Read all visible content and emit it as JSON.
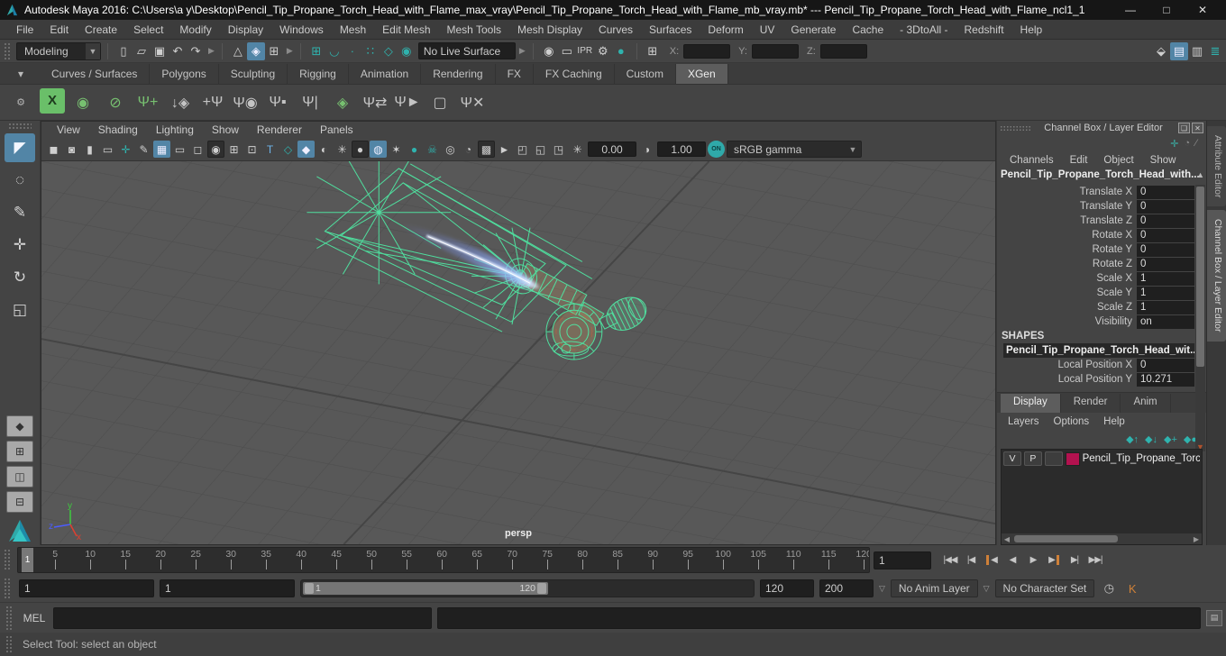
{
  "titlebar": {
    "title": "Autodesk Maya 2016: C:\\Users\\a y\\Desktop\\Pencil_Tip_Propane_Torch_Head_with_Flame_max_vray\\Pencil_Tip_Propane_Torch_Head_with_Flame_mb_vray.mb*  ---  Pencil_Tip_Propane_Torch_Head_with_Flame_ncl1_1",
    "minimize": "—",
    "maximize": "□",
    "close": "✕"
  },
  "menubar": {
    "items": [
      "File",
      "Edit",
      "Create",
      "Select",
      "Modify",
      "Display",
      "Windows",
      "Mesh",
      "Edit Mesh",
      "Mesh Tools",
      "Mesh Display",
      "Curves",
      "Surfaces",
      "Deform",
      "UV",
      "Generate",
      "Cache",
      "- 3DtoAll -",
      "Redshift",
      "Help"
    ]
  },
  "toolbar": {
    "mode_selector": "Modeling",
    "file_icons": [
      {
        "name": "new-scene-icon",
        "glyph": "▯"
      },
      {
        "name": "open-scene-icon",
        "glyph": "▱"
      },
      {
        "name": "save-scene-icon",
        "glyph": "▣"
      },
      {
        "name": "undo-icon",
        "glyph": "↶"
      },
      {
        "name": "redo-icon",
        "glyph": "↷"
      }
    ],
    "selection_icons": [
      {
        "name": "select-hierarchy-icon",
        "glyph": "△"
      },
      {
        "name": "select-object-icon",
        "glyph": "◈",
        "state": "active"
      },
      {
        "name": "select-component-icon",
        "glyph": "⊞"
      }
    ],
    "snap_icons": [
      {
        "name": "snap-grid-icon",
        "glyph": "⊞",
        "state": "teal"
      },
      {
        "name": "snap-curve-icon",
        "glyph": "◡",
        "state": "teal"
      },
      {
        "name": "snap-point-icon",
        "glyph": "∙",
        "state": "teal"
      },
      {
        "name": "snap-projected-center-icon",
        "glyph": "∷",
        "state": "teal"
      },
      {
        "name": "snap-view-plane-icon",
        "glyph": "◇",
        "state": "teal"
      },
      {
        "name": "make-live-icon",
        "glyph": "◉",
        "state": "teal"
      }
    ],
    "live_surface_value": "No Live Surface",
    "render_icons": [
      {
        "name": "render-view-icon",
        "glyph": "◉"
      },
      {
        "name": "render-current-frame-icon",
        "glyph": "▭"
      },
      {
        "name": "ipr-render-icon",
        "glyph": "IPR",
        "state": "small-t"
      },
      {
        "name": "render-settings-icon",
        "glyph": "⚙"
      },
      {
        "name": "current-renderer-icon",
        "glyph": "●",
        "state": "teal"
      }
    ],
    "symmetry_icon": {
      "name": "symmetry-icon",
      "glyph": "⊞"
    },
    "x_label": "X:",
    "y_label": "Y:",
    "z_label": "Z:",
    "sidebar_icons": [
      {
        "name": "modeling-toolkit-icon",
        "glyph": "⬙"
      },
      {
        "name": "channel-box-icon",
        "glyph": "▤",
        "state": "active"
      },
      {
        "name": "attribute-editor-icon",
        "glyph": "▥"
      },
      {
        "name": "tool-settings-icon",
        "glyph": "≣",
        "state": "teal"
      }
    ]
  },
  "shelf": {
    "tabs": [
      {
        "label": "Curves / Surfaces"
      },
      {
        "label": "Polygons"
      },
      {
        "label": "Sculpting"
      },
      {
        "label": "Rigging"
      },
      {
        "label": "Animation"
      },
      {
        "label": "Rendering"
      },
      {
        "label": "FX"
      },
      {
        "label": "FX Caching"
      },
      {
        "label": "Custom"
      },
      {
        "label": "XGen",
        "state": "active"
      }
    ],
    "menu_icon": "▾",
    "gear_icon": "⚙",
    "icons": [
      {
        "name": "xgen-editor-icon",
        "glyph": "X",
        "state": "box"
      },
      {
        "name": "xgen-update-preview-icon",
        "glyph": "◉",
        "state": "green"
      },
      {
        "name": "xgen-hide-preview-icon",
        "glyph": "⊘",
        "state": "green"
      },
      {
        "name": "xgen-create-description-icon",
        "glyph": "Ψ+",
        "state": "green"
      },
      {
        "name": "xgen-import-description-icon",
        "glyph": "↓◈"
      },
      {
        "name": "xgen-add-guide-icon",
        "glyph": "+Ψ"
      },
      {
        "name": "xgen-preview-description-icon",
        "glyph": "Ψ◉"
      },
      {
        "name": "xgen-lock-guides-icon",
        "glyph": "Ψ▪"
      },
      {
        "name": "xgen-mirror-guides-icon",
        "glyph": "Ψ|"
      },
      {
        "name": "xgen-layers-icon",
        "glyph": "◈",
        "state": "green"
      },
      {
        "name": "xgen-swap-guides-icon",
        "glyph": "Ψ⇄"
      },
      {
        "name": "xgen-select-guides-icon",
        "glyph": "Ψ►"
      },
      {
        "name": "xgen-region-map-icon",
        "glyph": "▢"
      },
      {
        "name": "xgen-delete-guides-icon",
        "glyph": "Ψ✕"
      }
    ]
  },
  "toolbox": {
    "tools": [
      {
        "name": "select-tool-button",
        "glyph": "◤",
        "state": "active"
      },
      {
        "name": "lasso-tool-button",
        "glyph": "◌"
      },
      {
        "name": "paint-select-tool-button",
        "glyph": "✎"
      },
      {
        "name": "move-tool-button",
        "glyph": "✛"
      },
      {
        "name": "rotate-tool-button",
        "glyph": "↻"
      },
      {
        "name": "scale-tool-button",
        "glyph": "◱"
      }
    ],
    "layouts": [
      {
        "name": "single-pane-layout-button",
        "glyph": "◆"
      },
      {
        "name": "four-pane-layout-button",
        "glyph": "⊞"
      },
      {
        "name": "persp-outliner-layout-button",
        "glyph": "◫"
      },
      {
        "name": "persp-graph-layout-button",
        "glyph": "⊟"
      }
    ]
  },
  "viewport": {
    "menus": [
      "View",
      "Shading",
      "Lighting",
      "Show",
      "Renderer",
      "Panels"
    ],
    "toolbar_icons": [
      {
        "name": "select-camera-icon",
        "glyph": "◼"
      },
      {
        "name": "camera-attributes-icon",
        "glyph": "◙"
      },
      {
        "name": "bookmark-icon",
        "glyph": "▮"
      },
      {
        "name": "image-plane-icon",
        "glyph": "▭"
      },
      {
        "name": "pan-zoom-icon",
        "glyph": "✛",
        "state": "teal"
      },
      {
        "name": "grease-pencil-icon",
        "glyph": "✎"
      },
      {
        "name": "grid-icon",
        "glyph": "▦",
        "state": "active"
      },
      {
        "name": "film-gate-icon",
        "glyph": "▭"
      },
      {
        "name": "resolution-gate-icon",
        "glyph": "◻"
      },
      {
        "name": "gate-mask-icon",
        "glyph": "◉",
        "state": "pressed"
      },
      {
        "name": "field-chart-icon",
        "glyph": "⊞"
      },
      {
        "name": "safe-action-icon",
        "glyph": "⊡"
      },
      {
        "name": "safe-title-icon",
        "glyph": "T",
        "state": "blue-text"
      },
      {
        "name": "wireframe-icon",
        "glyph": "◇",
        "state": "teal"
      },
      {
        "name": "shaded-icon",
        "glyph": "◆",
        "state": "active"
      },
      {
        "name": "textured-icon",
        "glyph": "◐"
      },
      {
        "name": "use-all-lights-icon",
        "glyph": "✳"
      },
      {
        "name": "shadows-icon",
        "glyph": "●",
        "state": "pressed"
      },
      {
        "name": "ambient-occlusion-icon",
        "glyph": "◍",
        "state": "active"
      },
      {
        "name": "motion-blur-icon",
        "glyph": "✶"
      },
      {
        "name": "default-material-icon",
        "glyph": "●",
        "state": "teal"
      },
      {
        "name": "xray-icon",
        "glyph": "☠",
        "state": "teal"
      },
      {
        "name": "xray-joints-icon",
        "glyph": "◎"
      },
      {
        "name": "backface-culling-icon",
        "glyph": "◔"
      },
      {
        "name": "transparency-sort-icon",
        "glyph": "▩",
        "state": "pressed"
      },
      {
        "name": "selection-preview-icon",
        "glyph": "►"
      },
      {
        "name": "isolate-select-icon",
        "glyph": "◰"
      },
      {
        "name": "isolate-add-icon",
        "glyph": "◱"
      },
      {
        "name": "isolate-view-icon",
        "glyph": "◳"
      }
    ],
    "exposure_icon": "✳",
    "exposure_value": "0.00",
    "contrast_icon": "◑",
    "contrast_value": "1.00",
    "on_label": "ON",
    "colorspace": "sRGB gamma",
    "colorspace_arrow": "▼",
    "camera_label": "persp",
    "axis_x": "x",
    "axis_y": "y",
    "axis_z": "z"
  },
  "channel_box": {
    "title": "Channel Box / Layer Editor",
    "float_icon": "❏",
    "close_icon": "✕",
    "manip_icons": [
      {
        "name": "channel-manipulator-icon",
        "glyph": "✛",
        "color": "#3bb0a5"
      },
      {
        "name": "channel-speed-icon",
        "glyph": "◔",
        "color": "#8a8a8a"
      },
      {
        "name": "channel-hyperbolic-icon",
        "glyph": "⁄",
        "color": "#8a8a8a"
      }
    ],
    "menus": [
      "Channels",
      "Edit",
      "Object",
      "Show"
    ],
    "node_name": "Pencil_Tip_Propane_Torch_Head_with...",
    "scroll_up_icon": "▲",
    "scroll_down_icon": "▼",
    "channels": [
      {
        "label": "Translate X",
        "value": "0"
      },
      {
        "label": "Translate Y",
        "value": "0"
      },
      {
        "label": "Translate Z",
        "value": "0"
      },
      {
        "label": "Rotate X",
        "value": "0"
      },
      {
        "label": "Rotate Y",
        "value": "0"
      },
      {
        "label": "Rotate Z",
        "value": "0"
      },
      {
        "label": "Scale X",
        "value": "1"
      },
      {
        "label": "Scale Y",
        "value": "1"
      },
      {
        "label": "Scale Z",
        "value": "1"
      },
      {
        "label": "Visibility",
        "value": "on"
      }
    ],
    "shapes_header": "SHAPES",
    "shape_node": "Pencil_Tip_Propane_Torch_Head_wit...",
    "shape_channels": [
      {
        "label": "Local Position X",
        "value": "0"
      },
      {
        "label": "Local Position Y",
        "value": "10.271"
      }
    ]
  },
  "layer_editor": {
    "tabs": [
      {
        "label": "Display",
        "state": "active"
      },
      {
        "label": "Render"
      },
      {
        "label": "Anim"
      }
    ],
    "menus": [
      "Layers",
      "Options",
      "Help"
    ],
    "icons": [
      {
        "name": "move-layer-up-icon",
        "glyph": "◆↑"
      },
      {
        "name": "move-layer-down-icon",
        "glyph": "◆↓"
      },
      {
        "name": "create-empty-layer-icon",
        "glyph": "◆+"
      },
      {
        "name": "create-layer-from-selected-icon",
        "glyph": "◆●"
      }
    ],
    "layer": {
      "visible": "V",
      "playback": "P",
      "name": "Pencil_Tip_Propane_Torc",
      "color": "#b3124f"
    },
    "hscroll_left": "◀",
    "hscroll_right": "▶"
  },
  "side_tabs": [
    {
      "label": "Attribute Editor"
    },
    {
      "label": "Channel Box / Layer Editor",
      "state": "active"
    }
  ],
  "timeline": {
    "tick_labels": [
      "5",
      "10",
      "15",
      "20",
      "25",
      "30",
      "35",
      "40",
      "45",
      "50",
      "55",
      "60",
      "65",
      "70",
      "75",
      "80",
      "85",
      "90",
      "95",
      "100",
      "105",
      "110",
      "115",
      "120"
    ],
    "current_marker": "1",
    "current_frame": "1",
    "playback_buttons": [
      {
        "name": "go-to-start-button",
        "glyph": "|◀◀"
      },
      {
        "name": "step-back-frame-button",
        "glyph": "|◀"
      },
      {
        "name": "step-back-key-button",
        "glyph": "◀",
        "bar": "bar-left"
      },
      {
        "name": "play-backwards-button",
        "glyph": "◀"
      },
      {
        "name": "play-forwards-button",
        "glyph": "▶"
      },
      {
        "name": "step-forward-key-button",
        "glyph": "▶",
        "bar": "bar-right"
      },
      {
        "name": "step-forward-frame-button",
        "glyph": "▶|"
      },
      {
        "name": "go-to-end-button",
        "glyph": "▶▶|"
      }
    ]
  },
  "range_slider": {
    "anim_start": "1",
    "playback_start": "1",
    "bar_start_label": "1",
    "bar_end_label": "120",
    "playback_end": "120",
    "anim_end": "200",
    "dropdown_arrow": "▽",
    "anim_layer": "No Anim Layer",
    "character_set": "No Character Set",
    "prefs_icon": "◷",
    "auto_key_icon": "K"
  },
  "command_line": {
    "label": "MEL",
    "script_editor_icon": "▤"
  },
  "help_line": {
    "text": "Select Tool: select an object"
  },
  "colors": {
    "highlight_blue": "#5285a6",
    "teal_accent": "#2fa9a9",
    "shelf_green": "#6abf69",
    "wireframe_green": "#4fe6a2",
    "flame_blue": "#9fc0ff",
    "layer_swatch": "#b3124f",
    "key_orange": "#cf8038"
  }
}
